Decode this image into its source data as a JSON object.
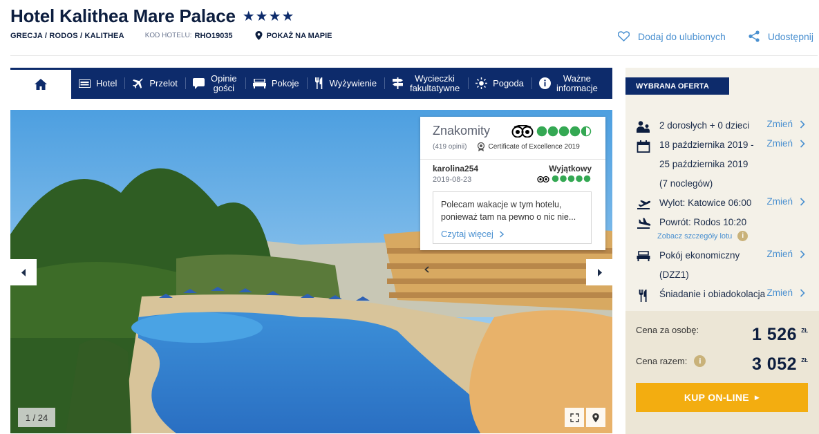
{
  "hotel": {
    "name": "Hotel Kalithea Mare Palace",
    "stars": "★★★★",
    "location": "GRECJA / RODOS / KALITHEA",
    "code_label": "KOD HOTELU:",
    "code_value": "RHO19035",
    "map_label": "POKAŻ NA MAPIE"
  },
  "actions": {
    "favorite_label": "Dodaj do ulubionych",
    "share_label": "Udostępnij"
  },
  "nav": {
    "items": [
      {
        "label": "Hotel",
        "icon": "hotel-icon"
      },
      {
        "label": "Przelot",
        "icon": "plane-icon"
      },
      {
        "label": "Opinie gości",
        "icon": "comment-icon"
      },
      {
        "label": "Pokoje",
        "icon": "bed-icon"
      },
      {
        "label": "Wyżywienie",
        "icon": "cutlery-icon"
      },
      {
        "label": "Wycieczki fakultatywne",
        "icon": "signpost-icon"
      },
      {
        "label": "Pogoda",
        "icon": "sun-icon"
      },
      {
        "label": "Ważne informacje",
        "icon": "info-icon"
      }
    ]
  },
  "gallery": {
    "counter": "1 / 24"
  },
  "tripadvisor": {
    "rating_label": "Znakomity",
    "reviews_count": "(419 opinii)",
    "certificate": "Certificate of Excellence 2019",
    "review": {
      "user": "karolina254",
      "date": "2019-08-23",
      "verdict": "Wyjątkowy",
      "text": "Polecam wakacje w tym hotelu, ponieważ tam na pewno o nic nie...",
      "more_label": "Czytaj więcej"
    },
    "bubble_color": "#34a853"
  },
  "offer": {
    "tag": "WYBRANA OFERTA",
    "change_label": "Zmień",
    "guests": "2 dorosłych + 0 dzieci",
    "dates_line1": "18 października 2019 -",
    "dates_line2": "25 października 2019",
    "dates_line3": "(7 noclegów)",
    "departure": "Wylot: Katowice 06:00",
    "return": "Powrót: Rodos 10:20",
    "flight_details": "Zobacz szczegóły lotu",
    "room_line1": "Pokój ekonomiczny",
    "room_line2": "(DZZ1)",
    "board": "Śniadanie i obiadokolacja",
    "price_person_label": "Cena za osobę:",
    "price_person": "1 526",
    "price_total_label": "Cena razem:",
    "price_total": "3 052",
    "currency": "ZŁ",
    "buy_label": "KUP ON-LINE"
  },
  "colors": {
    "navy": "#0d2b6b",
    "link": "#4a90d0",
    "buy": "#f3ad10",
    "panel": "#f4f1e8"
  }
}
